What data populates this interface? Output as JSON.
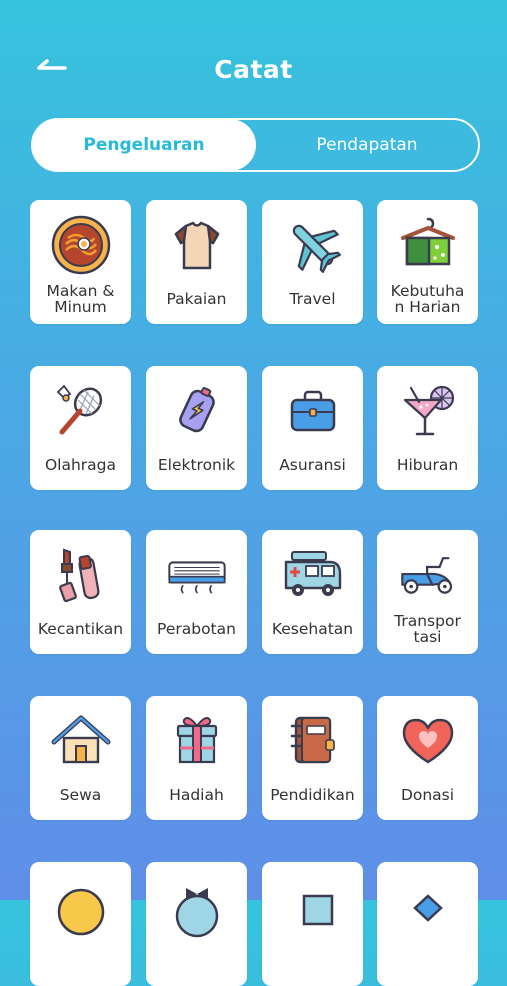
{
  "header": {
    "title": "Catat",
    "back_icon": "back-arrow-icon"
  },
  "tabs": {
    "active": "Pengeluaran",
    "inactive": "Pendapatan"
  },
  "categories": [
    {
      "label": "Makan & Minum",
      "icon": "food-bowl-icon"
    },
    {
      "label": "Pakaian",
      "icon": "shirt-icon"
    },
    {
      "label": "Travel",
      "icon": "airplane-icon"
    },
    {
      "label": "Kebutuhan Harian",
      "icon": "towel-hanger-icon"
    },
    {
      "label": "Olahraga",
      "icon": "badminton-icon"
    },
    {
      "label": "Elektronik",
      "icon": "powerbank-icon"
    },
    {
      "label": "Asuransi",
      "icon": "briefcase-icon"
    },
    {
      "label": "Hiburan",
      "icon": "cocktail-icon"
    },
    {
      "label": "Kecantikan",
      "icon": "cosmetics-icon"
    },
    {
      "label": "Perabotan",
      "icon": "air-conditioner-icon"
    },
    {
      "label": "Kesehatan",
      "icon": "ambulance-icon"
    },
    {
      "label": "Transportasi",
      "icon": "scooter-icon"
    },
    {
      "label": "Sewa",
      "icon": "house-icon"
    },
    {
      "label": "Hadiah",
      "icon": "gift-icon"
    },
    {
      "label": "Pendidikan",
      "icon": "book-icon"
    },
    {
      "label": "Donasi",
      "icon": "heart-icon"
    }
  ],
  "colors": {
    "accent": "#27b9de",
    "gradient_top": "#36c3dd",
    "gradient_bottom": "#5f8fe8"
  }
}
